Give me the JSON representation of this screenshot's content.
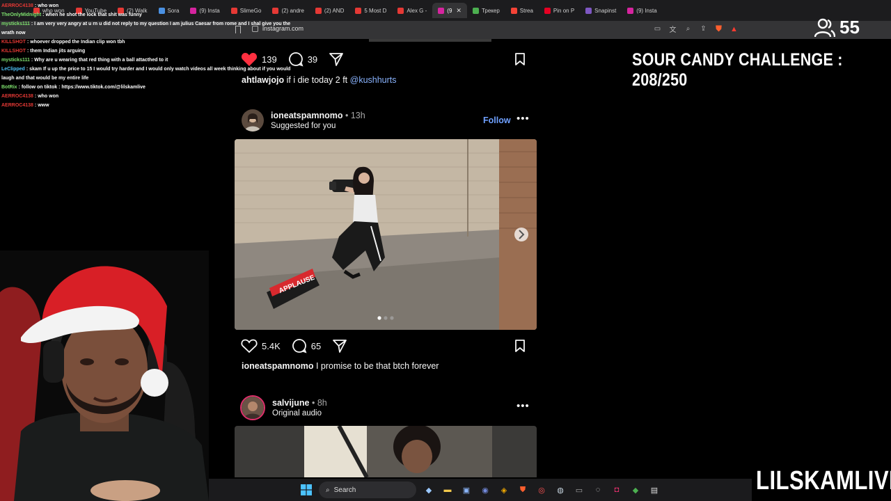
{
  "browser": {
    "tabs": [
      {
        "label": "who won",
        "color": "#e53935"
      },
      {
        "label": "YouTube",
        "color": "#e53935"
      },
      {
        "label": "(2) Walk",
        "color": "#e53935"
      },
      {
        "label": "Sora",
        "color": "#4a90e2"
      },
      {
        "label": "(9) Insta",
        "color": "#d6249f"
      },
      {
        "label": "SlimeGo",
        "color": "#e53935"
      },
      {
        "label": "(2) andre",
        "color": "#e53935"
      },
      {
        "label": "(2) AND",
        "color": "#e53935"
      },
      {
        "label": "5 Most D",
        "color": "#e53935"
      },
      {
        "label": "Alex G -",
        "color": "#e53935"
      },
      {
        "label": "(9",
        "color": "#d6249f",
        "active": true
      },
      {
        "label": "Трекер",
        "color": "#4caf50"
      },
      {
        "label": "Strea",
        "color": "#f44336"
      },
      {
        "label": "Pin on P",
        "color": "#e60023"
      },
      {
        "label": "Snapinst",
        "color": "#7e57c2"
      },
      {
        "label": "(9) Insta",
        "color": "#d6249f"
      }
    ],
    "url": "instagram.com"
  },
  "chat": [
    {
      "user": "AERROC4138",
      "text": ": who won",
      "color": "#e53935"
    },
    {
      "user": "TheOnlyMidnight",
      "text": ": when he shot the lock that shit was funny",
      "color": "#7ee06e"
    },
    {
      "user": "mysticks111",
      "text": ": I am very very angry at u rn u did not reply to my question I am julius Caesar from rome and I shal give you the wrath now",
      "color": "#7ee06e"
    },
    {
      "user": "KILLSHOT",
      "text": ": whoever dropped the Indian clip won tbh",
      "color": "#e53935"
    },
    {
      "user": "KILLSHOT",
      "text": ": them Indian jits arguing",
      "color": "#e53935"
    },
    {
      "user": "mysticks111",
      "text": ": Why are u wearing that red thing with a ball attacthed to it",
      "color": "#7ee06e"
    },
    {
      "user": "LeClipped",
      "text": ": skam If u up the price to 15 I would try harder and I would only watch videos all week thinking about if you would laugh and that would be my entire life",
      "color": "#4fc3f7"
    },
    {
      "user": "BotRix",
      "text": ": follow on tiktok : https://www.tiktok.com/@lilskamlive",
      "color": "#7ee06e"
    },
    {
      "user": "AERROC4138",
      "text": ": who won",
      "color": "#e53935"
    },
    {
      "user": "AERROC4138",
      "text": ": www",
      "color": "#e53935"
    }
  ],
  "overlay": {
    "viewers": "55",
    "challenge": "SOUR CANDY CHALLENGE : 208/250",
    "brand": "LILSKAMLIVE"
  },
  "feed": {
    "post1": {
      "likes": "139",
      "comments": "39",
      "caption_user": "ahtlawjojo",
      "caption_text": " if i die today 2 ft ",
      "caption_mention": "@kushhurts",
      "liked": true
    },
    "post2": {
      "username": "ioneatspamnomo",
      "time": "13h",
      "subtitle": "Suggested for you",
      "follow_label": "Follow",
      "likes": "5.4K",
      "comments": "65",
      "caption_user": "ioneatspamnomo",
      "caption_text": " I promise to be that btch forever",
      "carousel_index": 1,
      "carousel_count": 3,
      "sign_text": "APPLAUSE"
    },
    "post3": {
      "username": "salvijune",
      "time": "8h",
      "subtitle": "Original audio"
    }
  },
  "taskbar": {
    "search_label": "Search"
  }
}
